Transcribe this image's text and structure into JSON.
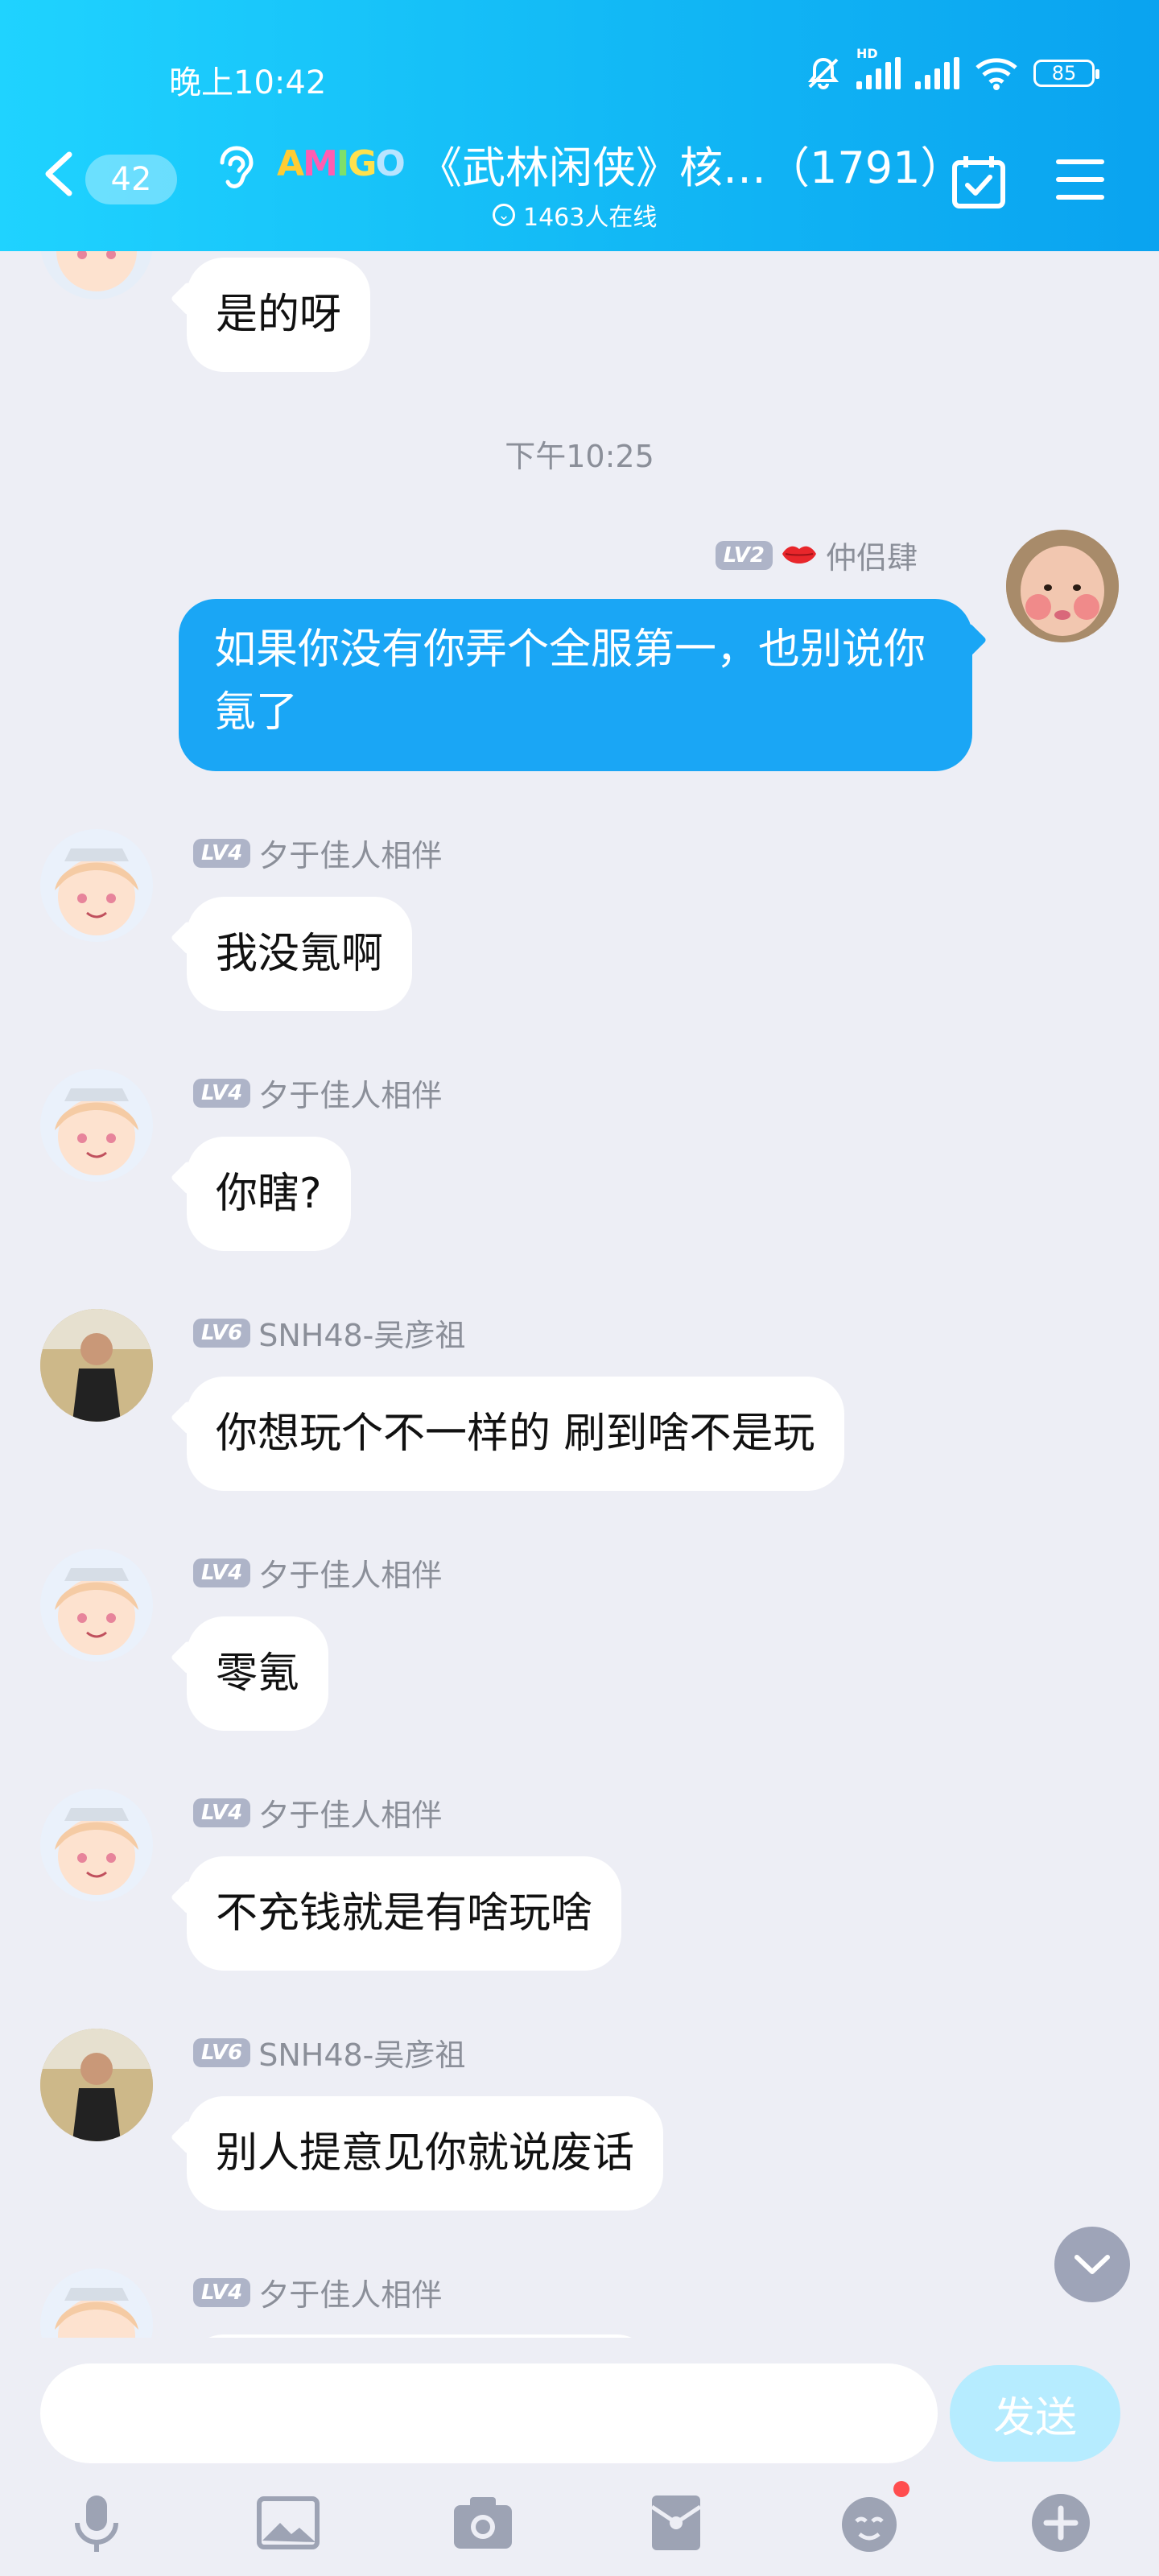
{
  "status_bar": {
    "time": "晚上10:42",
    "battery": "85",
    "hd_label": "HD"
  },
  "header": {
    "unread_count": "42",
    "logo_text": "AMIGO",
    "title": "《武林闲侠》核…（1791）",
    "online": "1463人在线"
  },
  "messages": [
    {
      "sender": "",
      "level": "",
      "text": "是的呀"
    },
    {
      "sender": "夕于佳人相伴",
      "level": "LV4",
      "text": "我没氪啊"
    },
    {
      "sender": "夕于佳人相伴",
      "level": "LV4",
      "text": "你瞎?"
    },
    {
      "sender": "SNH48-吴彦祖",
      "level": "LV6",
      "text": "你想玩个不一样的 刷到啥不是玩"
    },
    {
      "sender": "夕于佳人相伴",
      "level": "LV4",
      "text": "零氪"
    },
    {
      "sender": "夕于佳人相伴",
      "level": "LV4",
      "text": "不充钱就是有啥玩啥"
    },
    {
      "sender": "SNH48-吴彦祖",
      "level": "LV6",
      "text": "别人提意见你就说废话"
    },
    {
      "sender": "夕于佳人相伴",
      "level": "LV4",
      "text": ""
    }
  ],
  "timestamp": "下午10:25",
  "my_message": {
    "sender": "仲侣肆",
    "level": "LV2",
    "text": "如果你没有你弄个全服第一，也别说你氪了"
  },
  "composer": {
    "send_label": "发送",
    "placeholder": ""
  },
  "toolbar": [
    "microphone-icon",
    "image-icon",
    "camera-icon",
    "red-packet-icon",
    "emoji-icon",
    "plus-icon"
  ],
  "colors": {
    "header": "#12b8f5",
    "my_bubble": "#1aa6f5",
    "background": "#edeef5",
    "level_badge": "#aeb4c8"
  }
}
